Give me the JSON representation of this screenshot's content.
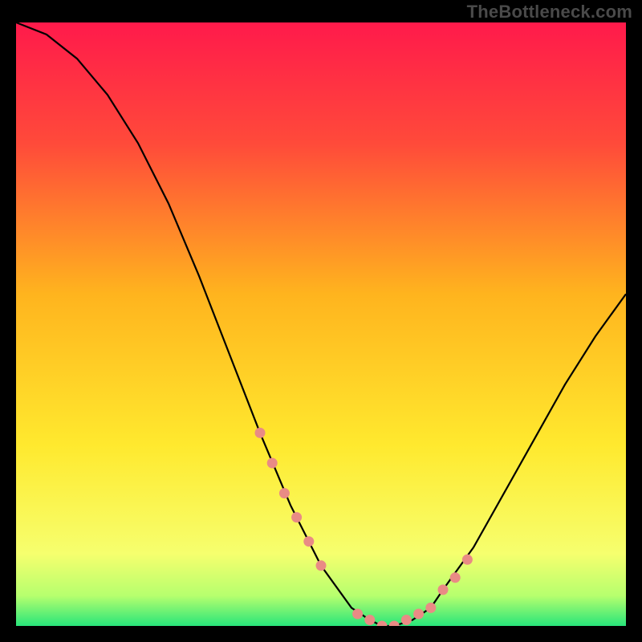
{
  "attribution": "TheBottleneck.com",
  "chart_data": {
    "type": "line",
    "title": "",
    "xlabel": "",
    "ylabel": "",
    "xlim": [
      0,
      100
    ],
    "ylim": [
      0,
      100
    ],
    "grid": false,
    "series": [
      {
        "name": "bottleneck-curve",
        "x": [
          0,
          5,
          10,
          15,
          20,
          25,
          30,
          35,
          40,
          45,
          50,
          55,
          58,
          60,
          62,
          65,
          68,
          70,
          75,
          80,
          85,
          90,
          95,
          100
        ],
        "y": [
          100,
          98,
          94,
          88,
          80,
          70,
          58,
          45,
          32,
          20,
          10,
          3,
          1,
          0,
          0,
          1,
          3,
          6,
          13,
          22,
          31,
          40,
          48,
          55
        ]
      }
    ],
    "markers": {
      "name": "highlight-points",
      "x": [
        40,
        42,
        44,
        46,
        48,
        50,
        56,
        58,
        60,
        62,
        64,
        66,
        68,
        70,
        72,
        74
      ],
      "y": [
        32,
        27,
        22,
        18,
        14,
        10,
        2,
        1,
        0,
        0,
        1,
        2,
        3,
        6,
        8,
        11
      ]
    },
    "background_gradient": {
      "stops": [
        {
          "pos": 0.0,
          "color": "#ff1a4b"
        },
        {
          "pos": 0.2,
          "color": "#ff4a3a"
        },
        {
          "pos": 0.45,
          "color": "#ffb41e"
        },
        {
          "pos": 0.7,
          "color": "#ffe92e"
        },
        {
          "pos": 0.88,
          "color": "#f6ff6e"
        },
        {
          "pos": 0.95,
          "color": "#b6ff6e"
        },
        {
          "pos": 1.0,
          "color": "#28e57a"
        }
      ]
    },
    "marker_color": "#e98b85",
    "line_color": "#000000"
  }
}
